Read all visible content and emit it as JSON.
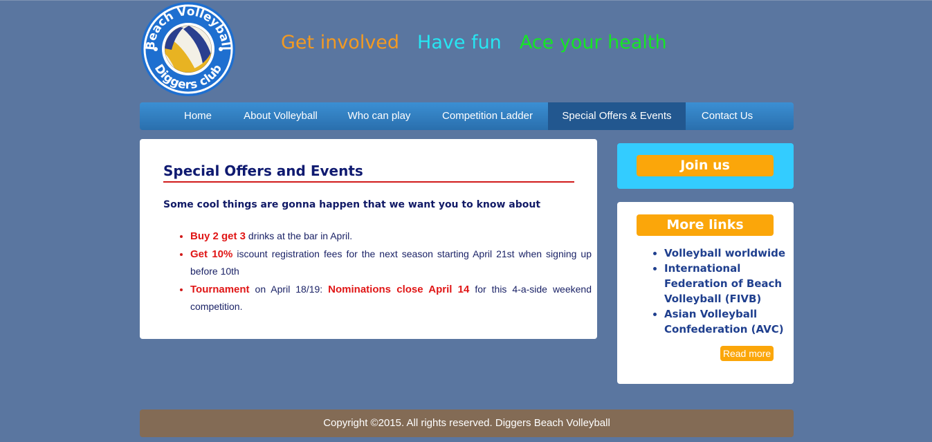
{
  "logo": {
    "top_text": "Beach Volleyball",
    "bottom_text": "Diggers club",
    "colors": {
      "ring": "#1e6fd0",
      "ball_gold": "#e8b322",
      "ball_blue": "#2a3f8f"
    }
  },
  "slogans": [
    "Get involved",
    "Have fun",
    "Ace your health"
  ],
  "nav": {
    "items": [
      {
        "label": "Home"
      },
      {
        "label": "About Volleyball"
      },
      {
        "label": "Who can play"
      },
      {
        "label": "Competition Ladder"
      },
      {
        "label": "Special Offers & Events",
        "active": true
      },
      {
        "label": "Contact Us"
      }
    ]
  },
  "main": {
    "title": "Special Offers and Events",
    "intro": "Some cool things are gonna happen that we want you to know about",
    "items": [
      {
        "highlight": "Buy 2 get 3",
        "text": " drinks at the bar in April."
      },
      {
        "highlight": "Get 10%",
        "text": " iscount registration fees for the next season starting April 21st when signing up before 10th"
      },
      {
        "highlight": "Tournament",
        "text_a": " on April 18/19: ",
        "highlight_b": "Nominations close April 14",
        "text_b": " for this 4-a-side weekend competition."
      }
    ]
  },
  "sidebar": {
    "join_label": "Join us",
    "more_links_label": "More links",
    "links": [
      "Volleyball worldwide",
      "International Federation of Beach Volleyball (FIVB)",
      "Asian Volleyball Confederation (AVC)"
    ],
    "read_more_label": "Read more"
  },
  "footer": {
    "text": "Copyright ©2015. All rights reserved. Diggers Beach Volleyball"
  },
  "colors": {
    "background": "#5a76a0",
    "nav": "#2f7fc3",
    "nav_active": "#22578f",
    "title": "#0f1a70",
    "highlight": "#e01616",
    "orange": "#fba60a",
    "join_bg": "#33ccff",
    "footer": "#836b55"
  }
}
